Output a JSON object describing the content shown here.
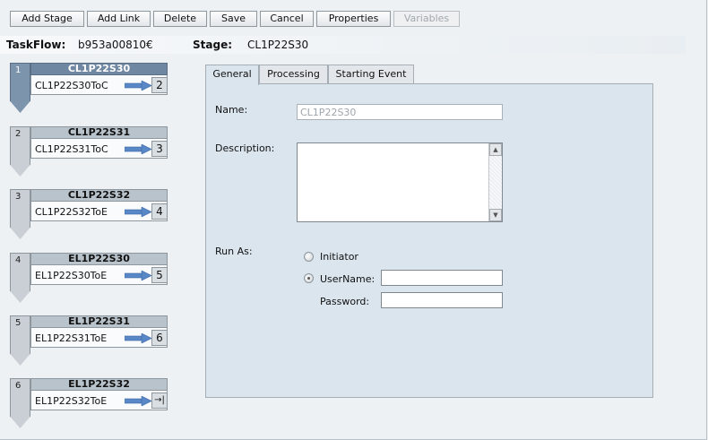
{
  "toolbar": {
    "buttons": [
      {
        "label": "Add Stage",
        "enabled": true
      },
      {
        "label": "Add Link",
        "enabled": true
      },
      {
        "label": "Delete",
        "enabled": true
      },
      {
        "label": "Save",
        "enabled": true
      },
      {
        "label": "Cancel",
        "enabled": true
      },
      {
        "label": "Properties",
        "enabled": true
      },
      {
        "label": "Variables",
        "enabled": false
      }
    ]
  },
  "info": {
    "taskflow_label": "TaskFlow:",
    "taskflow_value": "b953a00810€",
    "stage_label": "Stage:",
    "stage_value": "CL1P22S30"
  },
  "stages": [
    {
      "num": "1",
      "title": "CL1P22S30",
      "link": "CL1P22S30ToC",
      "next": "2",
      "selected": true
    },
    {
      "num": "2",
      "title": "CL1P22S31",
      "link": "CL1P22S31ToC",
      "next": "3",
      "selected": false
    },
    {
      "num": "3",
      "title": "CL1P22S32",
      "link": "CL1P22S32ToE",
      "next": "4",
      "selected": false
    },
    {
      "num": "4",
      "title": "EL1P22S30",
      "link": "EL1P22S30ToE",
      "next": "5",
      "selected": false
    },
    {
      "num": "5",
      "title": "EL1P22S31",
      "link": "EL1P22S31ToE",
      "next": "6",
      "selected": false
    },
    {
      "num": "6",
      "title": "EL1P22S32",
      "link": "EL1P22S32ToE",
      "next": "→|",
      "selected": false
    }
  ],
  "tabs": [
    "General",
    "Processing",
    "Starting Event"
  ],
  "active_tab": "General",
  "form": {
    "name_label": "Name:",
    "name_value": "CL1P22S30",
    "description_label": "Description:",
    "description_value": "",
    "run_as_label": "Run As:",
    "initiator_label": "Initiator",
    "username_label": "UserName:",
    "username_value": "",
    "password_label": "Password:",
    "password_value": "",
    "run_as_selected": "UserName"
  },
  "colors": {
    "background": "#eef1f4",
    "panel": "#dbe5ee",
    "selected_stage": "#6f87a1",
    "arrow": "#5a87c6"
  },
  "icons": {
    "link_arrow": "right-arrow-icon",
    "end_marker": "end-arrow-icon"
  }
}
